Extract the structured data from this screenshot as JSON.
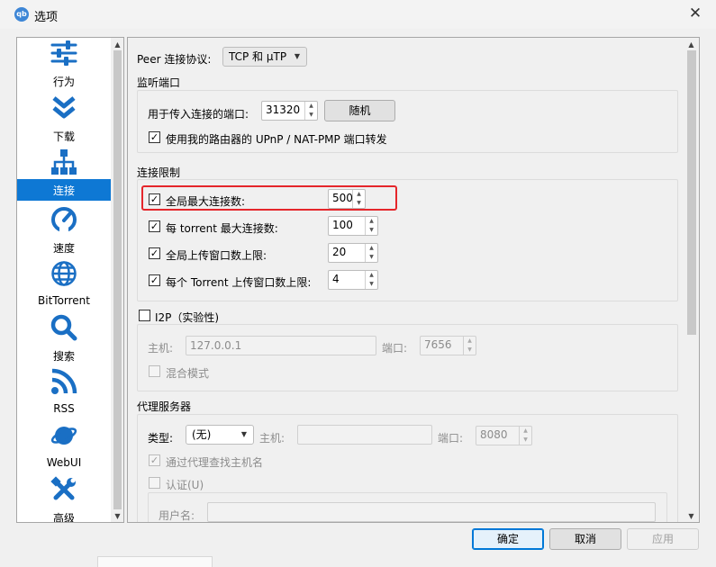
{
  "window": {
    "title": "选项",
    "icon_text": "qb"
  },
  "sidebar": {
    "items": [
      {
        "label": "行为",
        "icon": "sliders-icon"
      },
      {
        "label": "下载",
        "icon": "double-chevron-down-icon"
      },
      {
        "label": "连接",
        "icon": "network-icon",
        "selected": true
      },
      {
        "label": "速度",
        "icon": "speedometer-icon"
      },
      {
        "label": "BitTorrent",
        "icon": "globe-icon"
      },
      {
        "label": "搜索",
        "icon": "magnifier-icon"
      },
      {
        "label": "RSS",
        "icon": "rss-icon"
      },
      {
        "label": "WebUI",
        "icon": "planet-icon"
      },
      {
        "label": "高级",
        "icon": "tools-icon"
      }
    ]
  },
  "connection": {
    "protocol_label": "Peer 连接协议:",
    "protocol_value": "TCP 和 µTP",
    "listen_port": {
      "title": "监听端口",
      "port_label": "用于传入连接的端口:",
      "port_value": "31320",
      "random_button": "随机",
      "upnp_label": "使用我的路由器的 UPnP / NAT-PMP 端口转发",
      "upnp_checked": true
    },
    "limits": {
      "title": "连接限制",
      "rows": [
        {
          "label": "全局最大连接数:",
          "value": "500",
          "checked": true,
          "highlighted": true
        },
        {
          "label": "每 torrent 最大连接数:",
          "value": "100",
          "checked": true
        },
        {
          "label": "全局上传窗口数上限:",
          "value": "20",
          "checked": true
        },
        {
          "label": "每个 Torrent 上传窗口数上限:",
          "value": "4",
          "checked": true
        }
      ]
    },
    "i2p": {
      "title": "I2P（实验性)",
      "checked": false,
      "host_label": "主机:",
      "host_value": "127.0.0.1",
      "port_label": "端口:",
      "port_value": "7656",
      "mixed_label": "混合模式"
    },
    "proxy": {
      "title": "代理服务器",
      "type_label": "类型:",
      "type_value": "(无)",
      "host_label": "主机:",
      "host_value": "",
      "port_label": "端口:",
      "port_value": "8080",
      "lookup_label": "通过代理查找主机名",
      "lookup_checked": true,
      "auth_label": "认证(U)",
      "auth_checked": false,
      "username_label": "用户名:"
    }
  },
  "footer": {
    "ok": "确定",
    "cancel": "取消",
    "apply": "应用"
  },
  "colors": {
    "selection": "#0e78d4",
    "highlight_box": "#e5262b",
    "icon_blue": "#1a6fc4"
  }
}
